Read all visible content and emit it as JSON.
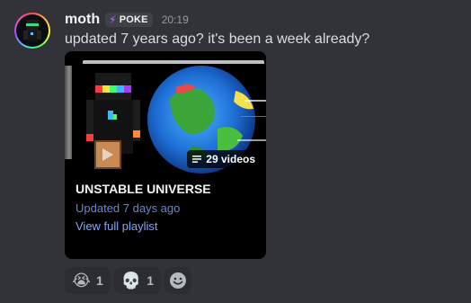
{
  "message": {
    "author": "moth",
    "tag": {
      "label": "POKE",
      "icon": "lightning-icon",
      "color": "#b967ff"
    },
    "timestamp": "20:19",
    "text": "updated 7 years ago? it's been a week already?"
  },
  "embed": {
    "title": "UNSTABLE UNIVERSE",
    "updated": "Updated 7 days ago",
    "link": "View full playlist",
    "video_count": "29 videos",
    "link_color": "#7fa4ff"
  },
  "reactions": [
    {
      "emoji": "😭",
      "count": "1",
      "icon": "loudly-crying-face-icon"
    },
    {
      "emoji": "💀",
      "count": "1",
      "icon": "skull-icon"
    }
  ],
  "add_reaction": {
    "icon": "smiley-add-reaction-icon"
  }
}
